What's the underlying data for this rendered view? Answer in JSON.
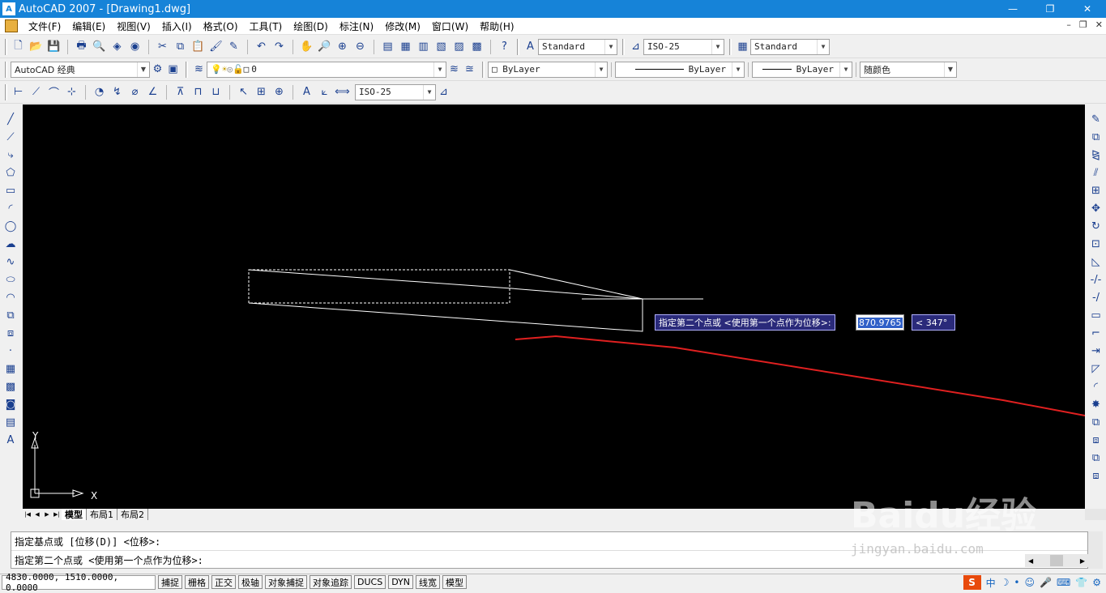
{
  "window": {
    "title": "AutoCAD 2007 - [Drawing1.dwg]",
    "app_icon_text": "A",
    "controls": [
      "—",
      "❐",
      "✕"
    ],
    "mdi_controls": [
      "–",
      "❐",
      "✕"
    ]
  },
  "menu": [
    "文件(F)",
    "编辑(E)",
    "视图(V)",
    "插入(I)",
    "格式(O)",
    "工具(T)",
    "绘图(D)",
    "标注(N)",
    "修改(M)",
    "窗口(W)",
    "帮助(H)"
  ],
  "toolbar1": {
    "text_style": "Standard",
    "dim_style": "ISO-25",
    "table_style": "Standard"
  },
  "toolbar2": {
    "workspace": "AutoCAD 经典",
    "layer": "0",
    "color": "ByLayer",
    "linetype": "ByLayer",
    "lineweight": "ByLayer",
    "plotstyle": "随颜色"
  },
  "toolbar3": {
    "dim_style": "ISO-25"
  },
  "canvas": {
    "dyn_prompt": "指定第二个点或 <使用第一个点作为位移>:",
    "dyn_value": "870.9765",
    "dyn_angle": "< 347°",
    "ucs_x": "X",
    "ucs_y": "Y"
  },
  "layout_tabs": [
    "模型",
    "布局1",
    "布局2"
  ],
  "command": {
    "line1": "指定基点或 [位移(D)] <位移>:",
    "line2": "指定第二个点或 <使用第一个点作为位移>:"
  },
  "status": {
    "coords": "4830.0000, 1510.0000, 0.0000",
    "buttons": [
      "捕捉",
      "栅格",
      "正交",
      "极轴",
      "对象捕捉",
      "对象追踪",
      "DUCS",
      "DYN",
      "线宽",
      "模型"
    ],
    "tray": [
      "S",
      "中",
      "☽",
      "•",
      "☺",
      "🎤",
      "⌨",
      "👕",
      "⚙"
    ]
  },
  "watermark": {
    "brand": "Baidu经验",
    "url": "jingyan.baidu.com"
  },
  "colors": {
    "titlebar": "#1683d8",
    "canvas_bg": "#000000",
    "annotation_red": "#e02020"
  }
}
